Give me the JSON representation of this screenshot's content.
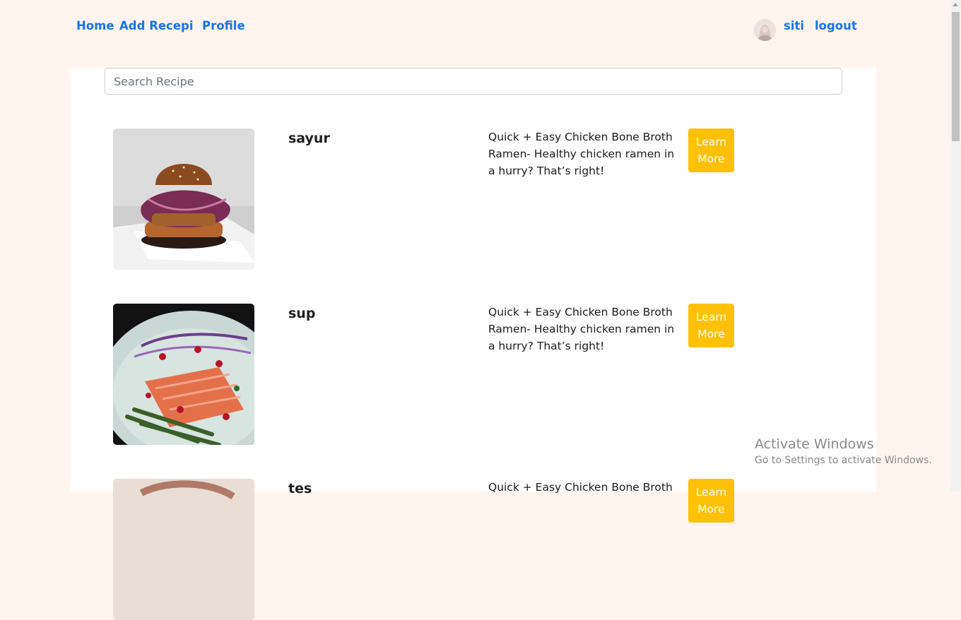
{
  "nav": {
    "home": "Home",
    "add_recipe": "Add Recepi",
    "profile": "Profile",
    "username": "siti",
    "logout": "logout"
  },
  "search": {
    "placeholder": "Search Recipe"
  },
  "recipes": [
    {
      "title": "sayur",
      "description": "Quick + Easy Chicken Bone Broth Ramen- Healthy chicken ramen in a hurry? That’s right!",
      "button": "Learn More",
      "image": "burger-image"
    },
    {
      "title": "sup",
      "description": "Quick + Easy Chicken Bone Broth Ramen- Healthy chicken ramen in a hurry? That’s right!",
      "button": "Learn More",
      "image": "salmon-image"
    },
    {
      "title": "tes",
      "description": "Quick + Easy Chicken Bone Broth",
      "button": "Learn More",
      "image": "food-image"
    }
  ],
  "watermark": {
    "line1": "Activate Windows",
    "line2": "Go to Settings to activate Windows."
  },
  "colors": {
    "link": "#1a73e8",
    "button": "#ffc107",
    "background": "#fff5ee"
  }
}
